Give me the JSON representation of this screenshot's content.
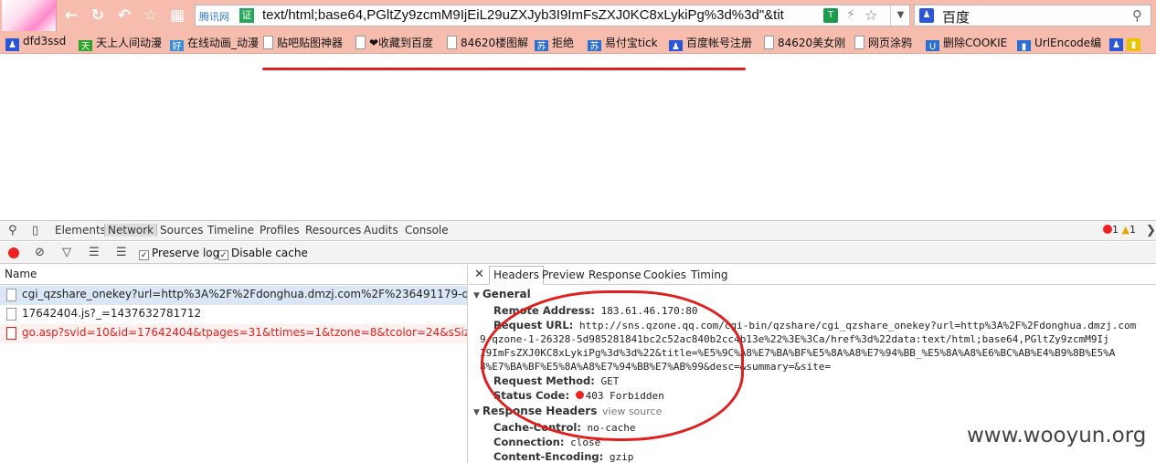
{
  "toolbar": {
    "site_label": "腾讯网",
    "badge_label": "证",
    "url": "text/html;base64,PGltZy9zcmM9IjEiL29uZXJyb3I9ImFsZXJ0KC8xLykiPg%3d%3d\"&tit",
    "search_engine": "百度"
  },
  "bookmarks": [
    {
      "label": "dfd3ssd",
      "icon": "paw-icon",
      "color": "#2b56d6"
    },
    {
      "label": "天上人间动漫",
      "icon": "tian-icon",
      "color": "#2aa52a"
    },
    {
      "label": "在线动画_动漫",
      "icon": "haoting-icon",
      "color": "#3a8fd8"
    },
    {
      "label": "贴吧贴图神器",
      "icon": "page-icon",
      "color": "#ffffff"
    },
    {
      "label": "❤收藏到百度",
      "icon": "page-icon",
      "color": "#ffffff"
    },
    {
      "label": "84620楼图解",
      "icon": "page-icon",
      "color": "#ffffff"
    },
    {
      "label": "拒绝",
      "icon": "su-icon",
      "color": "#2d6fd0"
    },
    {
      "label": "易付宝tick",
      "icon": "su-icon",
      "color": "#2d6fd0"
    },
    {
      "label": "百度帐号注册",
      "icon": "paw-icon",
      "color": "#2b56d6"
    },
    {
      "label": "84620美女刚",
      "icon": "page-icon",
      "color": "#ffffff"
    },
    {
      "label": "网页涂鸦",
      "icon": "page-icon",
      "color": "#ffffff"
    },
    {
      "label": "删除COOKIE",
      "icon": "shield-icon",
      "color": "#2d6fd0"
    },
    {
      "label": "UrlEncode编",
      "icon": "bars-icon",
      "color": "#2d6fd0"
    }
  ],
  "devtools": {
    "tabs": [
      "Elements",
      "Network",
      "Sources",
      "Timeline",
      "Profiles",
      "Resources",
      "Audits",
      "Console"
    ],
    "active_tab": "Network",
    "error_count": "1",
    "warning_count": "1",
    "preserve_log": "Preserve log",
    "disable_cache": "Disable cache",
    "name_header": "Name",
    "requests": [
      {
        "name": "cgi_qzshare_onekey?url=http%3A%2F%2Fdonghua.dmzj.com%2F%236491179-qzone-1...",
        "state": "selected"
      },
      {
        "name": "17642404.js?_=1437632781712",
        "state": "normal"
      },
      {
        "name": "go.asp?svid=10&id=17642404&tpages=31&ttimes=1&tzone=8&tcolor=24&sSize=1366...",
        "state": "error"
      }
    ],
    "detail_tabs": [
      "Headers",
      "Preview",
      "Response",
      "Cookies",
      "Timing"
    ],
    "active_detail_tab": "Headers",
    "general": {
      "title": "General",
      "remote_address_key": "Remote Address:",
      "remote_address": "183.61.46.170:80",
      "request_url_key": "Request URL:",
      "request_url_1": "http://sns.qzone.qq.com/cgi-bin/qzshare/cgi_qzshare_onekey?url=http%3A%2F%2Fdonghua.dmzj.com",
      "request_url_2": "9-qzone-1-26328-5d985281841bc2c52ac840b2cc4b13e%22%3E%3Ca/href%3d%22data:text/html;base64,PGltZy9zcmM9Ij",
      "request_url_3": "I9ImFsZXJ0KC8xLykiPg%3d%3d%22&title=%E5%9C%A8%E7%BA%BF%E5%8A%A8%E7%94%BB_%E5%8A%A8%E6%BC%AB%E4%B9%8B%E5%A",
      "request_url_4": "8%E7%BA%BF%E5%8A%A8%E7%94%BB%E7%AB%99&desc=&summary=&site=",
      "method_key": "Request Method:",
      "method": "GET",
      "status_key": "Status Code:",
      "status": "403 Forbidden"
    },
    "response_headers": {
      "title": "Response Headers",
      "view_source": "view source",
      "cache_control_key": "Cache-Control:",
      "cache_control": "no-cache",
      "connection_key": "Connection:",
      "connection": "close",
      "encoding_key": "Content-Encoding:",
      "encoding": "gzip"
    }
  },
  "watermark": "www.wooyun.org",
  "colors": {
    "toolbar_bg": "#f6bcae",
    "annotation_red": "#e0201f",
    "error_red": "#e22"
  }
}
